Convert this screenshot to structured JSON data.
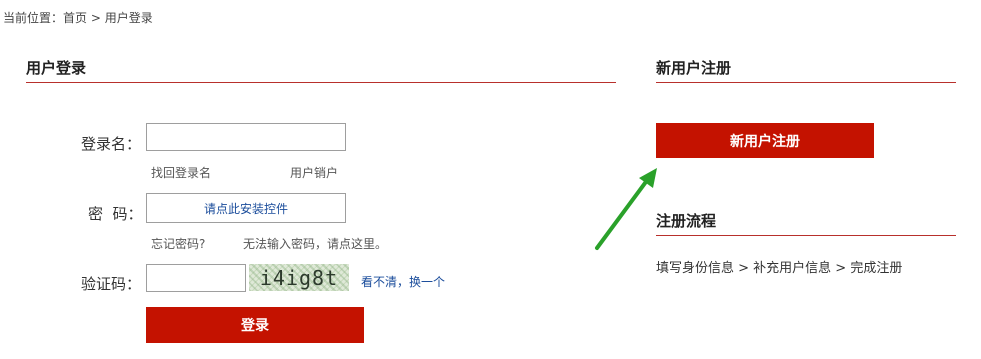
{
  "breadcrumb": {
    "prefix": "当前位置：",
    "home": "首页",
    "separator": " > ",
    "current": "用户登录"
  },
  "login": {
    "title": "用户登录",
    "username_label": "登录名：",
    "username_value": "",
    "recover_username_link": "找回登录名",
    "deactivate_link": "用户销户",
    "password_label": "密  码：",
    "password_install_link": "请点此安装控件",
    "forgot_password_link": "忘记密码?",
    "cannot_input_link": "无法输入密码，请点这里。",
    "captcha_label": "验证码：",
    "captcha_value": "",
    "captcha_text": "i4ig8t",
    "refresh_captcha_link": "看不清，换一个",
    "submit_label": "登录"
  },
  "register": {
    "title": "新用户注册",
    "button_label": "新用户注册",
    "process_title": "注册流程",
    "process_steps": "填写身份信息 > 补充用户信息 > 完成注册"
  },
  "colors": {
    "accent_red": "#c41200",
    "rule_red": "#b8302c",
    "link_blue": "#1a4c9b",
    "arrow_green": "#2aa12a"
  },
  "icons": {
    "annotation": "green-arrow-icon"
  }
}
